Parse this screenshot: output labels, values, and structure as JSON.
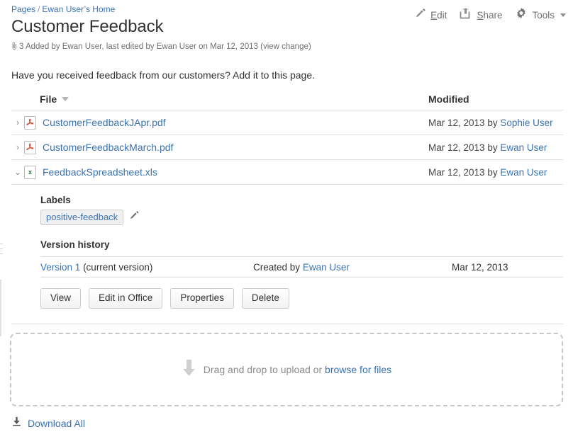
{
  "breadcrumb": {
    "root": "Pages",
    "separator": "/",
    "parent": "Ewan User’s Home"
  },
  "header": {
    "title": "Customer Feedback",
    "meta_count": "3",
    "meta_text": "Added by Ewan User, last edited by Ewan User on Mar 12, 2013",
    "view_change": "(view change)"
  },
  "actions": [
    {
      "label": "Edit",
      "icon": "pencil-icon",
      "accesskey": "E"
    },
    {
      "label": "Share",
      "icon": "share-icon",
      "accesskey": "S"
    },
    {
      "label": "Tools",
      "icon": "gear-icon",
      "accesskey": ""
    }
  ],
  "intro": "Have you received feedback from our customers? Add it to this page.",
  "table": {
    "columns": {
      "file": "File",
      "modified": "Modified"
    },
    "sort_icon": "sort-descending-icon",
    "rows": [
      {
        "name": "CustomerFeedbackJApr.pdf",
        "icon": "pdf-file-icon",
        "expanded": false,
        "twisty": "›",
        "modified_date": "Mar 12, 2013",
        "modified_by_prefix": "by",
        "modified_by": "Sophie User"
      },
      {
        "name": "CustomerFeedbackMarch.pdf",
        "icon": "pdf-file-icon",
        "expanded": false,
        "twisty": "›",
        "modified_date": "Mar 12, 2013",
        "modified_by_prefix": "by",
        "modified_by": "Ewan User"
      },
      {
        "name": "FeedbackSpreadsheet.xls",
        "icon": "xls-file-icon",
        "expanded": true,
        "twisty": "⌄",
        "modified_date": "Mar 12, 2013",
        "modified_by_prefix": "by",
        "modified_by": "Ewan User"
      }
    ]
  },
  "detail": {
    "labels_heading": "Labels",
    "labels": [
      "positive-feedback"
    ],
    "edit_labels_icon": "pencil-icon",
    "version_heading": "Version history",
    "version_row": {
      "version": "Version 1",
      "current_note": "(current version)",
      "created_prefix": "Created by",
      "created_by": "Ewan User",
      "date": "Mar 12, 2013"
    },
    "buttons": [
      "View",
      "Edit in Office",
      "Properties",
      "Delete"
    ]
  },
  "dropzone": {
    "icon": "download-arrow-icon",
    "text": "Drag and drop to upload or",
    "link": "browse for files"
  },
  "footer": {
    "icon": "download-icon",
    "label": "Download All"
  },
  "colors": {
    "link": "#3b73af",
    "text": "#333333",
    "muted": "#707070",
    "border": "#dddddd",
    "pdf_red": "#d04b3a",
    "xls_green": "#1e7a3c"
  }
}
